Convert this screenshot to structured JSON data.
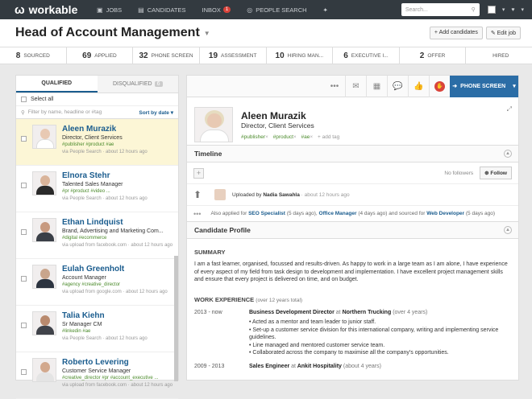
{
  "nav": {
    "logo": "workable",
    "items": [
      {
        "label": "JOBS",
        "icon": "briefcase-icon"
      },
      {
        "label": "CANDIDATES",
        "icon": "people-icon"
      },
      {
        "label": "INBOX",
        "icon": "inbox-icon",
        "badge": "1"
      },
      {
        "label": "PEOPLE SEARCH",
        "icon": "target-icon"
      }
    ],
    "search_placeholder": "Search..."
  },
  "header": {
    "job_title": "Head of Account Management",
    "add_candidates": "+ Add candidates",
    "edit_job": "Edit job"
  },
  "pipeline": [
    {
      "count": "8",
      "label": "SOURCED"
    },
    {
      "count": "69",
      "label": "APPLIED"
    },
    {
      "count": "32",
      "label": "PHONE SCREEN"
    },
    {
      "count": "19",
      "label": "ASSESSMENT"
    },
    {
      "count": "10",
      "label": "HIRING MAN..."
    },
    {
      "count": "6",
      "label": "EXECUTIVE I..."
    },
    {
      "count": "2",
      "label": "OFFER"
    },
    {
      "count": "",
      "label": "HIRED"
    }
  ],
  "list": {
    "tab_qualified": "QUALIFIED",
    "tab_disqualified": "DISQUALIFIED",
    "disqualified_count": "6",
    "select_all": "Select all",
    "filter_placeholder": "Filter by name, headline or #tag",
    "sort": "Sort by date",
    "candidates": [
      {
        "name": "Aleen Murazik",
        "title": "Director, Client Services",
        "tags": "#publisher #product #ae",
        "via": "via People Search · about 12 hours ago"
      },
      {
        "name": "Elnora Stehr",
        "title": "Talented Sales Manager",
        "tags": "#pr #product #video ...",
        "via": "via People Search · about 12 hours ago"
      },
      {
        "name": "Ethan Lindquist",
        "title": "Brand, Advertising and Marketing Com...",
        "tags": "#digital #ecommerce",
        "via": "via upload from facebook.com · about 12 hours ago"
      },
      {
        "name": "Eulah Greenholt",
        "title": "Account Manager",
        "tags": "#agency #creative_director",
        "via": "via upload from google.com · about 12 hours ago"
      },
      {
        "name": "Talia Kiehn",
        "title": "Sr Manager CM",
        "tags": "#linkedin #ae",
        "via": "via People Search · about 12 hours ago"
      },
      {
        "name": "Roberto Levering",
        "title": "Customer Service Manager",
        "tags": "#creative_director #pr #account_executive ...",
        "via": "via upload from facebook.com · about 12 hours ago"
      }
    ]
  },
  "profile": {
    "phone_screen_btn": "PHONE SCREEN",
    "name": "Aleen Murazik",
    "title": "Director, Client Services",
    "tags": [
      "#publisher",
      "#product",
      "#ae"
    ],
    "add_tag": "+ add tag"
  },
  "timeline": {
    "heading": "Timeline",
    "no_followers": "No followers",
    "follow": "Follow",
    "uploaded_by": "Uploaded by",
    "uploader": "Nadia Sawahla",
    "upload_time": "· about 12 hours ago",
    "also_prefix": "Also applied for",
    "job1": "SEO Specialist",
    "job1_time": "(5 days ago),",
    "job2": "Office Manager",
    "job2_time": "(4 days ago) and sourced for",
    "job3": "Web Developer",
    "job3_time": "(5 days ago)"
  },
  "candidate_profile": {
    "heading": "Candidate Profile",
    "summary_heading": "SUMMARY",
    "summary_text": "I am a fast learner, organised, focussed and results-driven. As happy to work in a large team as I am alone, I have experience of every aspect of my field from task design to development and implementation. I have excellent project management skills and ensure that every project is delivered on time, and on budget.",
    "work_heading": "WORK EXPERIENCE",
    "work_total": "(over 12 years total)",
    "jobs": [
      {
        "dates": "2013 - now",
        "position": "Business Development Director",
        "at": "at",
        "company": "Northern Trucking",
        "duration": "(over 4 years)",
        "bullets": [
          "• Acted as a mentor and team leader to junior staff.",
          "• Set-up a customer service division for this international company, writing and implementing service guidelines.",
          "• Line managed and mentored customer service team.",
          "• Collaborated across the company to maximise all the company's opportunities."
        ]
      },
      {
        "dates": "2009 - 2013",
        "position": "Sales Engineer",
        "at": "at",
        "company": "Ankit Hospitality",
        "duration": "(about 4 years)",
        "bullets": []
      }
    ]
  }
}
